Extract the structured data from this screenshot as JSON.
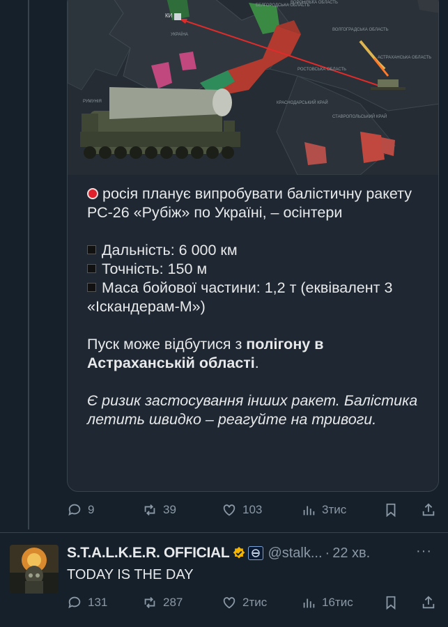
{
  "quoted_post": {
    "map_labels": {
      "kyiv": "КИ",
      "ukraine": "УКРАЇНА",
      "belgorod": "БЕЛГОРОДСЬКА ОБЛАСТЬ",
      "voronezh": "ВОРОНІЗЬКА ОБЛАСТЬ",
      "volgograd": "ВОЛГОГРАДСЬКА ОБЛАСТЬ",
      "rostov": "РОСТОВСЬКА ОБЛАСТЬ",
      "astrakhan": "АСТРАХАНСЬКА ОБЛАСТЬ",
      "romania": "РУМУНІЯ",
      "krasnodar": "КРАСНОДАРСЬКИЙ КРАЙ",
      "stavropol": "СТАВРОПОЛЬСЬКИЙ КРАЙ"
    },
    "headline": "росія планує випробувати балістичну ракету РС-26 «Рубіж» по Україні, – осінтери",
    "specs": [
      "Дальність: 6 000 км",
      "Точність: 150 м",
      "Маса бойової частини: 1,2 т (еквівалент 3 «Іскандерам-М»)"
    ],
    "launch_prefix": "Пуск може відбутися з ",
    "launch_bold": "полігону в Астраханській області",
    "launch_suffix": ".",
    "warning": "Є ризик застосування інших ракет. Балістика летить швидко – реагуйте на тривоги."
  },
  "post_actions": {
    "replies": "9",
    "reposts": "39",
    "likes": "103",
    "views": "3тис"
  },
  "reply": {
    "author": "S.T.A.L.K.E.R. OFFICIAL",
    "handle": "@stalk...",
    "separator": "·",
    "time": "22 хв.",
    "more": "···",
    "text": "TODAY IS THE DAY",
    "actions": {
      "replies": "131",
      "reposts": "287",
      "likes": "2тис",
      "views": "16тис"
    }
  },
  "colors": {
    "background": "#15202b",
    "muted": "#8b98a5",
    "verified": "#f4b400",
    "alert_red": "#e0212b"
  }
}
